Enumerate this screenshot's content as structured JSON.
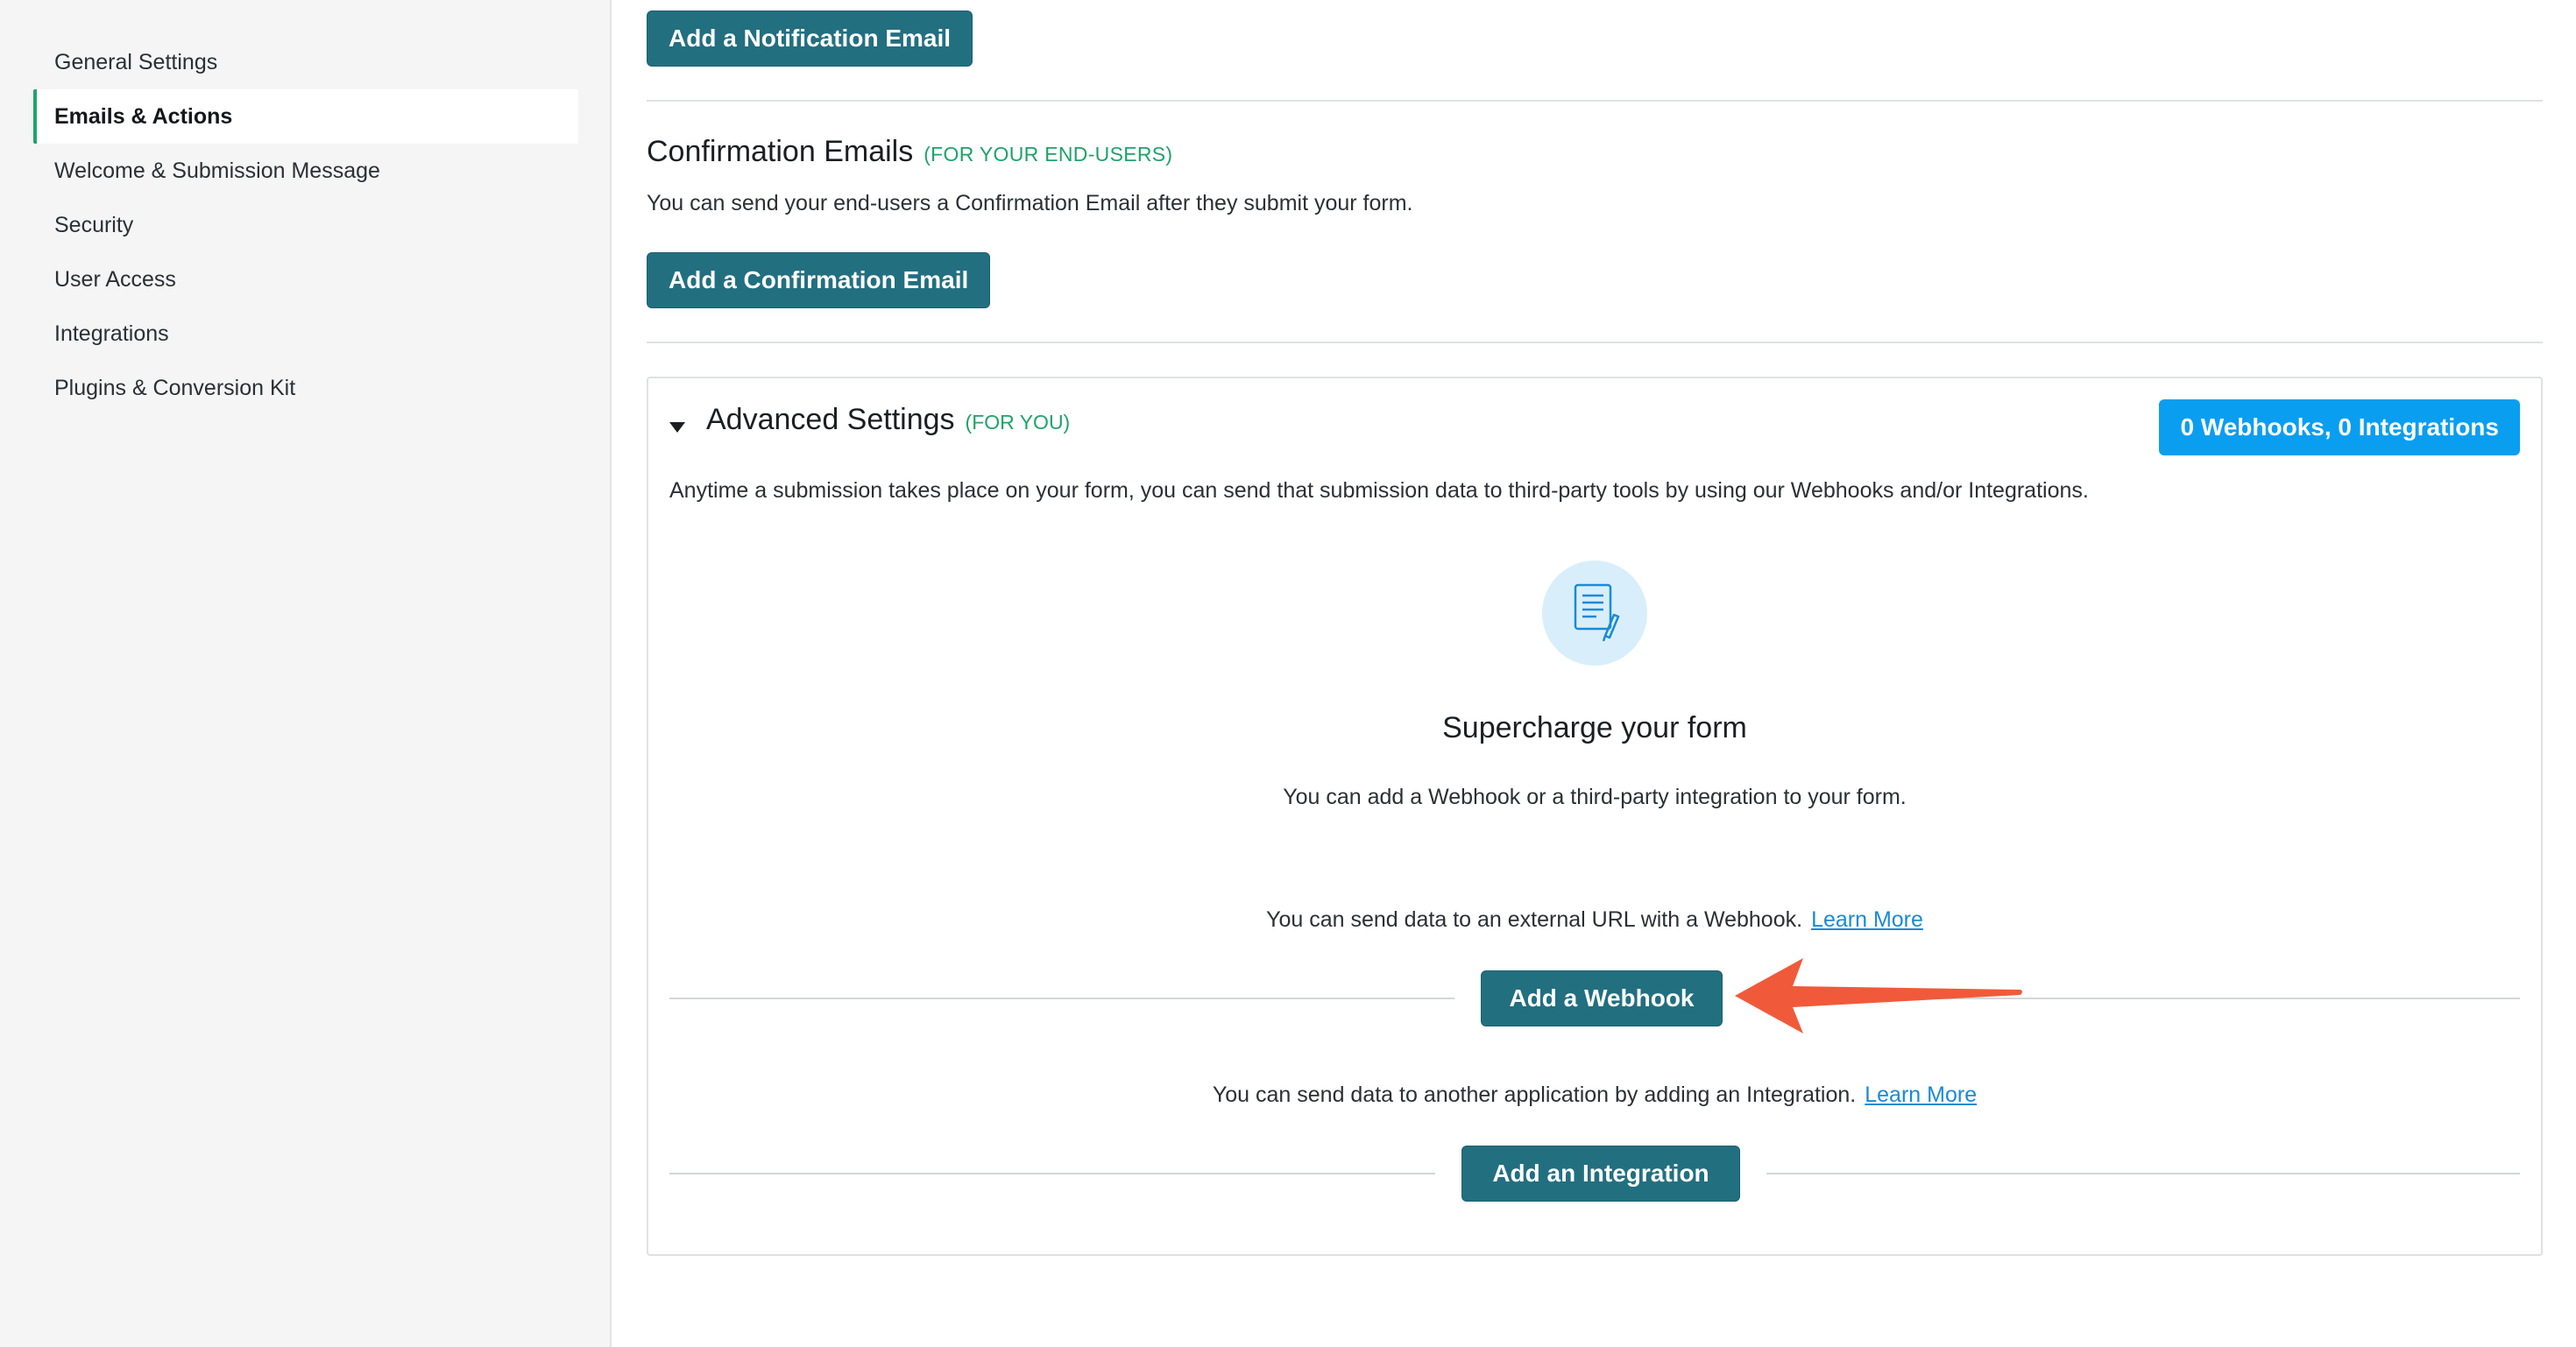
{
  "sidebar": {
    "items": [
      {
        "label": "General Settings",
        "active": false
      },
      {
        "label": "Emails & Actions",
        "active": true
      },
      {
        "label": "Welcome & Submission Message",
        "active": false
      },
      {
        "label": "Security",
        "active": false
      },
      {
        "label": "User Access",
        "active": false
      },
      {
        "label": "Integrations",
        "active": false
      },
      {
        "label": "Plugins & Conversion Kit",
        "active": false
      }
    ]
  },
  "notification": {
    "button_label": "Add a Notification Email"
  },
  "confirmation": {
    "title": "Confirmation Emails",
    "tag": "(FOR YOUR END-USERS)",
    "description": "You can send your end-users a Confirmation Email after they submit your form.",
    "button_label": "Add a Confirmation Email"
  },
  "advanced": {
    "title": "Advanced Settings",
    "tag": "(FOR YOU)",
    "count_badge": "0 Webhooks, 0 Integrations",
    "description": "Anytime a submission takes place on your form, you can send that submission data to third-party tools by using our Webhooks and/or Integrations.",
    "icon": "document-pen-icon",
    "hero_title": "Supercharge your form",
    "hero_subtitle": "You can add a Webhook or a third-party integration to your form.",
    "webhook": {
      "text": "You can send data to an external URL with a Webhook.",
      "link": "Learn More",
      "button_label": "Add a Webhook"
    },
    "integration": {
      "text": "You can send data to another application by adding an Integration.",
      "link": "Learn More",
      "button_label": "Add an Integration"
    }
  },
  "colors": {
    "primary_button": "#226f80",
    "accent_green": "#1ea36b",
    "badge_blue": "#0a9ef0",
    "link_blue": "#1a8ad6",
    "annotation_arrow": "#f05a3a"
  }
}
